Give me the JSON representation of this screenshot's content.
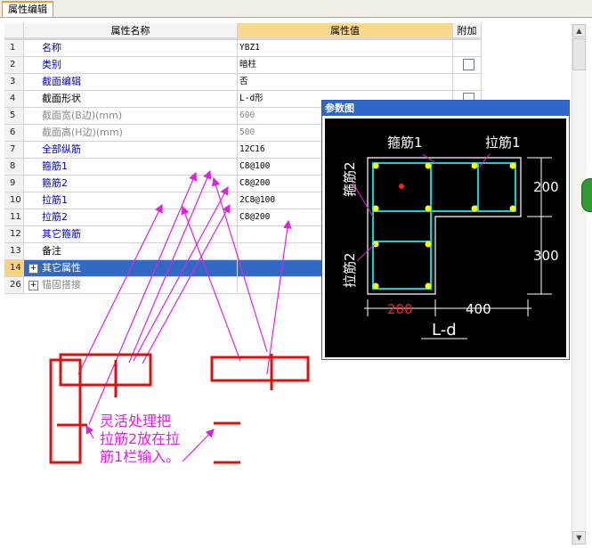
{
  "tab": {
    "label": "属性编辑"
  },
  "grid": {
    "headers": {
      "name": "属性名称",
      "value": "属性值",
      "add": "附加"
    },
    "rows": [
      {
        "no": "1",
        "name": "名称",
        "value": "YBZ1",
        "style": "blue",
        "check": false,
        "expand": false
      },
      {
        "no": "2",
        "name": "类别",
        "value": "暗柱",
        "style": "blue",
        "check": true,
        "expand": false
      },
      {
        "no": "3",
        "name": "截面编辑",
        "value": "否",
        "style": "blue",
        "check": false,
        "expand": false
      },
      {
        "no": "4",
        "name": "截面形状",
        "value": "L-d形",
        "style": "",
        "check": true,
        "expand": false
      },
      {
        "no": "5",
        "name": "截面宽(B边)(mm)",
        "value": "600",
        "style": "gray",
        "check": false,
        "expand": false
      },
      {
        "no": "6",
        "name": "截面高(H边)(mm)",
        "value": "500",
        "style": "gray",
        "check": false,
        "expand": false
      },
      {
        "no": "7",
        "name": "全部纵筋",
        "value": "12C16",
        "style": "blue",
        "check": false,
        "expand": false
      },
      {
        "no": "8",
        "name": "箍筋1",
        "value": "C8@100",
        "style": "blue",
        "check": false,
        "expand": false
      },
      {
        "no": "9",
        "name": "箍筋2",
        "value": "C8@200",
        "style": "blue",
        "check": false,
        "expand": false
      },
      {
        "no": "10",
        "name": "拉筋1",
        "value": "2C8@100",
        "style": "blue",
        "check": false,
        "expand": false
      },
      {
        "no": "11",
        "name": "拉筋2",
        "value": "C8@200",
        "style": "blue",
        "check": false,
        "expand": false
      },
      {
        "no": "12",
        "name": "其它箍筋",
        "value": "",
        "style": "blue",
        "check": false,
        "expand": false
      },
      {
        "no": "13",
        "name": "备注",
        "value": "",
        "style": "",
        "check": false,
        "expand": false
      },
      {
        "no": "14",
        "name": "其它属性",
        "value": "",
        "style": "sel",
        "check": false,
        "expand": true
      },
      {
        "no": "26",
        "name": "锚固搭接",
        "value": "",
        "style": "gray",
        "check": false,
        "expand": true
      }
    ]
  },
  "panel": {
    "title": "参数图",
    "labels": {
      "gujin1": "箍筋1",
      "lajin1": "拉筋1",
      "gujin2": "箍筋2",
      "lajin2": "拉筋2"
    },
    "dims": {
      "d200v": "200",
      "d300v": "300",
      "d200h": "200",
      "d400h": "400"
    },
    "shape_label": "L-d"
  },
  "annotation": {
    "lines": [
      "灵活处理把",
      "拉筋2放在拉",
      "筋1栏输入。"
    ]
  },
  "colors": {
    "magenta": "#e020e0",
    "red": "#e01010",
    "cyan": "#00d8d8",
    "yellow": "#ffff00",
    "selection": "#316ac5"
  }
}
